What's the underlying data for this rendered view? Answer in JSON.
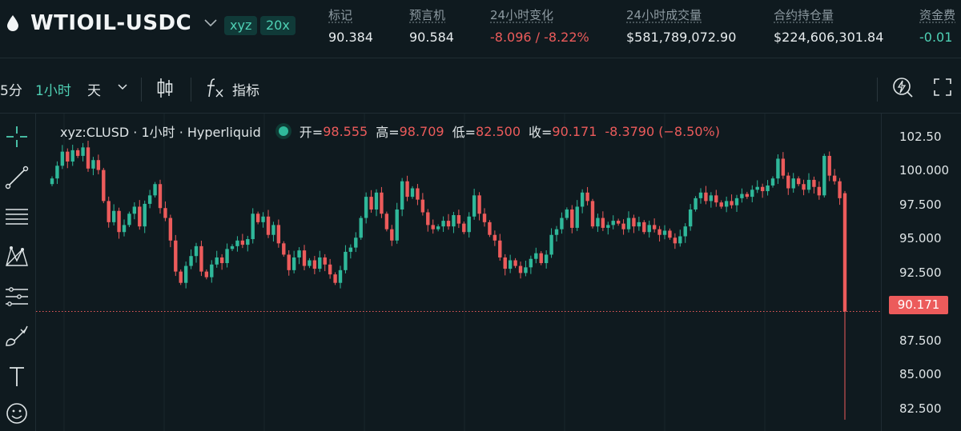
{
  "header": {
    "symbol": "WTIOIL-USDC",
    "badges": [
      "xyz",
      "20x"
    ],
    "stats": [
      {
        "label": "标记",
        "value": "90.384",
        "tone": "normal"
      },
      {
        "label": "预言机",
        "value": "90.584",
        "tone": "normal"
      },
      {
        "label": "24小时变化",
        "value": "-8.096 / -8.22%",
        "tone": "red"
      },
      {
        "label": "24小时成交量",
        "value": "$581,789,072.90",
        "tone": "normal"
      },
      {
        "label": "合约持仓量",
        "value": "$224,606,301.84",
        "tone": "normal"
      },
      {
        "label": "资金费",
        "value": "-0.01",
        "tone": "teal"
      }
    ]
  },
  "toolbar": {
    "intervals": [
      "5分",
      "1小时",
      "天"
    ],
    "active_interval": "1小时",
    "indicators_label": "指标"
  },
  "legend": {
    "symbol": "xyz:CLUSD · 1小时 · Hyperliquid",
    "open_label": "开=",
    "open": "98.555",
    "high_label": "高=",
    "high": "98.709",
    "low_label": "低=",
    "low": "82.500",
    "close_label": "收=",
    "close": "90.171",
    "change": "-8.3790 (−8.50%)"
  },
  "colors": {
    "up": "#2fb89a",
    "down": "#ec5b5b",
    "background": "#0f1a1f",
    "accent": "#4fd1b5"
  },
  "chart_data": {
    "type": "candlestick",
    "y_ticks": [
      "102.50",
      "100.000",
      "97.500",
      "95.000",
      "92.500",
      "87.500",
      "85.000",
      "82.500"
    ],
    "ylim": [
      81.7,
      104.2
    ],
    "last_price": "90.171",
    "closes": [
      99.6,
      100.5,
      101.5,
      100.8,
      101.6,
      101.2,
      101.8,
      100.3,
      100.9,
      100.2,
      98.0,
      96.5,
      97.3,
      95.8,
      96.3,
      97.1,
      97.6,
      96.2,
      97.8,
      98.4,
      99.2,
      97.5,
      96.8,
      95.2,
      93.0,
      92.2,
      93.4,
      94.1,
      94.8,
      93.0,
      92.6,
      93.5,
      94.0,
      93.6,
      94.6,
      94.8,
      95.2,
      94.9,
      95.3,
      97.1,
      96.5,
      96.9,
      95.6,
      96.3,
      95.0,
      94.2,
      93.1,
      94.0,
      94.5,
      93.4,
      93.8,
      93.2,
      94.0,
      93.5,
      92.8,
      92.2,
      93.1,
      94.4,
      94.7,
      95.4,
      96.8,
      98.3,
      97.4,
      98.6,
      97.1,
      96.0,
      95.2,
      97.4,
      99.4,
      98.3,
      98.9,
      98.1,
      97.2,
      96.3,
      96.0,
      96.2,
      96.6,
      96.2,
      97.0,
      96.4,
      95.8,
      96.9,
      98.4,
      97.1,
      96.5,
      95.6,
      95.2,
      94.0,
      93.2,
      93.8,
      93.4,
      92.9,
      93.3,
      93.9,
      94.3,
      93.6,
      94.2,
      95.6,
      96.0,
      96.8,
      97.4,
      96.1,
      97.6,
      98.6,
      98.0,
      96.2,
      96.8,
      96.1,
      96.3,
      96.6,
      96.4,
      96.0,
      96.8,
      96.2,
      96.5,
      95.8,
      96.3,
      96.0,
      95.6,
      95.9,
      95.4,
      95.0,
      95.5,
      96.2,
      97.4,
      98.2,
      98.6,
      98.0,
      98.4,
      97.9,
      97.6,
      98.0,
      97.7,
      98.2,
      98.5,
      98.3,
      98.8,
      99.0,
      98.7,
      99.1,
      99.6,
      101.0,
      99.8,
      98.9,
      99.6,
      99.2,
      98.8,
      99.5,
      99.0,
      98.4,
      101.2,
      99.8,
      99.4,
      98.2,
      90.171
    ]
  }
}
